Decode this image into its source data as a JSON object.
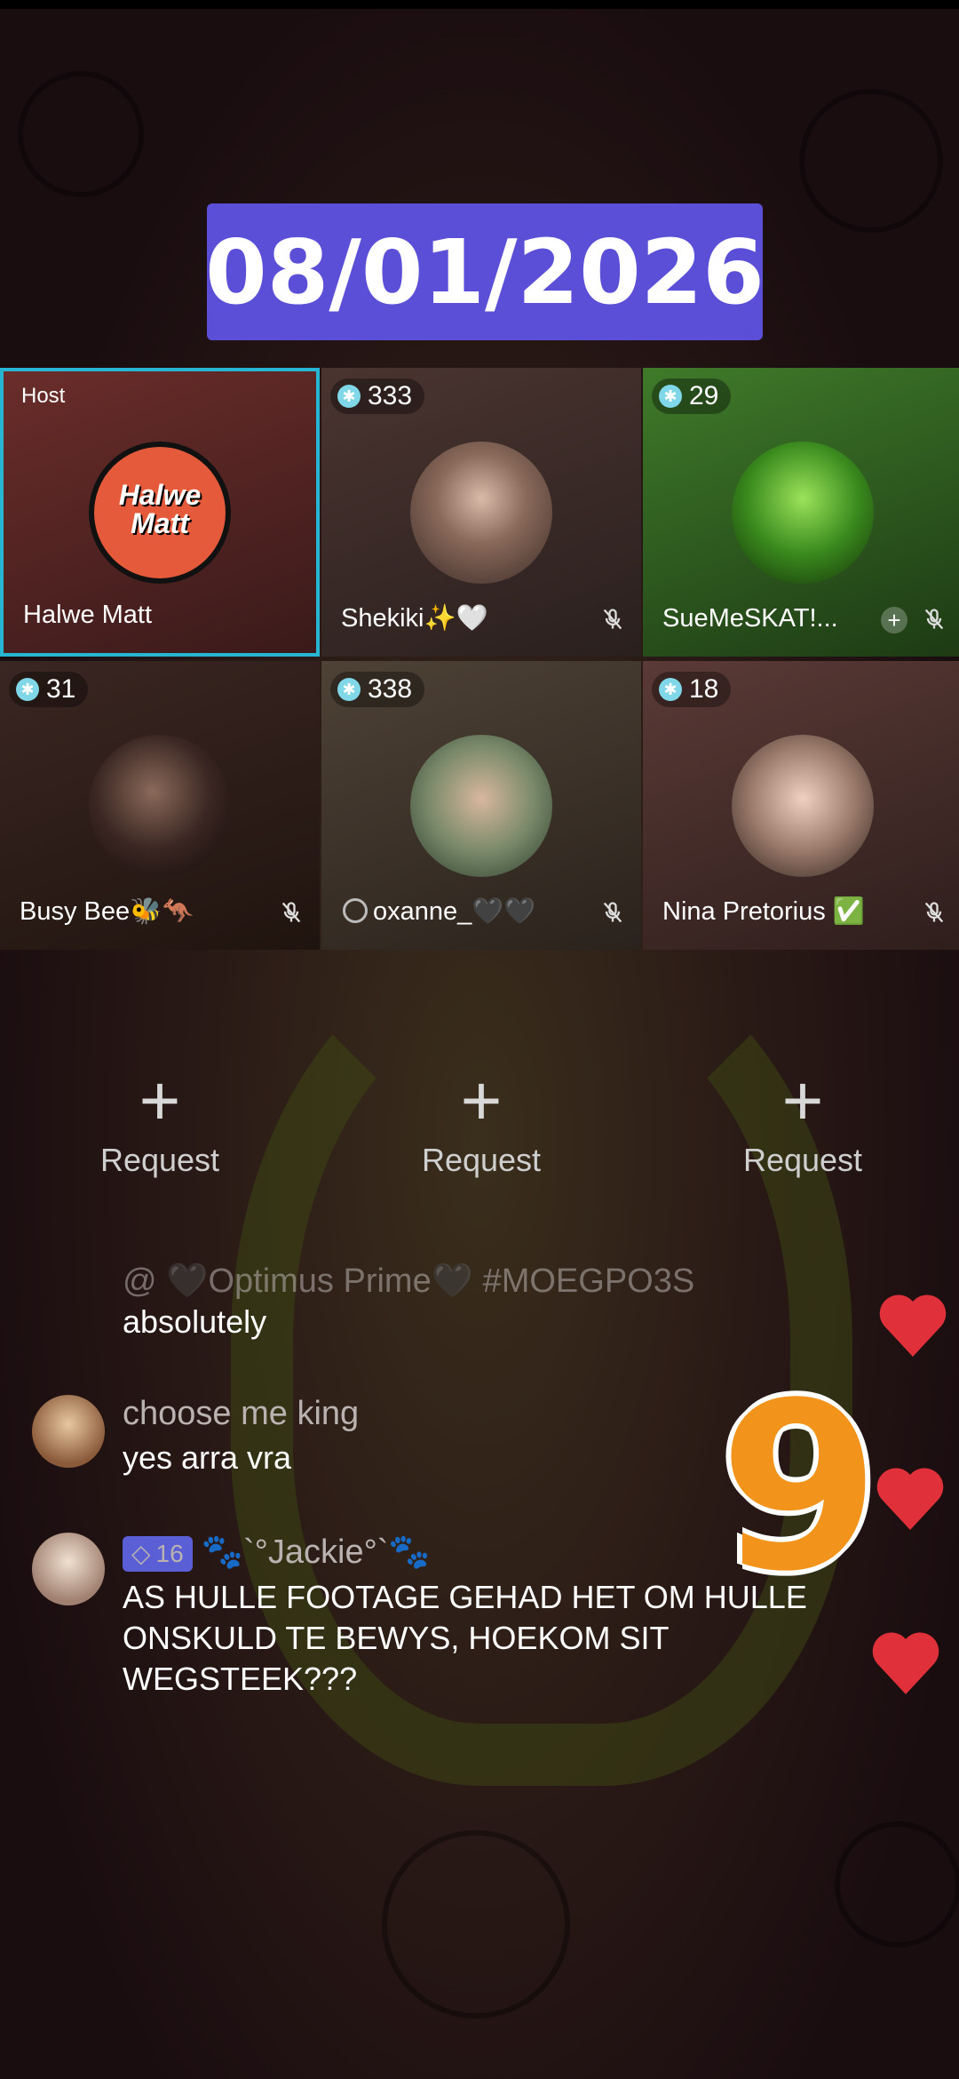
{
  "date_banner": "08/01/2026",
  "grid": {
    "tiles": [
      {
        "role": "Host",
        "name": "Halwe Matt",
        "logo_text": "Halwe Matt"
      },
      {
        "count": "333",
        "name": "Shekiki✨🤍"
      },
      {
        "count": "29",
        "name": "SueMeSKAT!..."
      },
      {
        "count": "31",
        "name": "Busy Bee🐝🦘"
      },
      {
        "count": "338",
        "name": "oxanne_🖤🖤"
      },
      {
        "count": "18",
        "name": "Nina Pretorius ✅"
      }
    ],
    "request_label": "Request"
  },
  "chat": {
    "messages": [
      {
        "name": "@ 🖤Optimus Prime🖤 #MOEGPO3S",
        "text": "absolutely"
      },
      {
        "name": "choose me king",
        "text": "yes arra vra"
      },
      {
        "level": "16",
        "name": "🐾`°Jackie°`🐾",
        "text": "AS HULLE FOOTAGE GEHAD HET OM HULLE ONSKULD TE BEWYS, HOEKOM SIT WEGSTEEK???"
      }
    ]
  },
  "overlay_number": "9",
  "colors": {
    "accent": "#5a4fd6",
    "host_border": "#26b6d4",
    "heart": "#e0313a",
    "nine": "#f2941c"
  }
}
